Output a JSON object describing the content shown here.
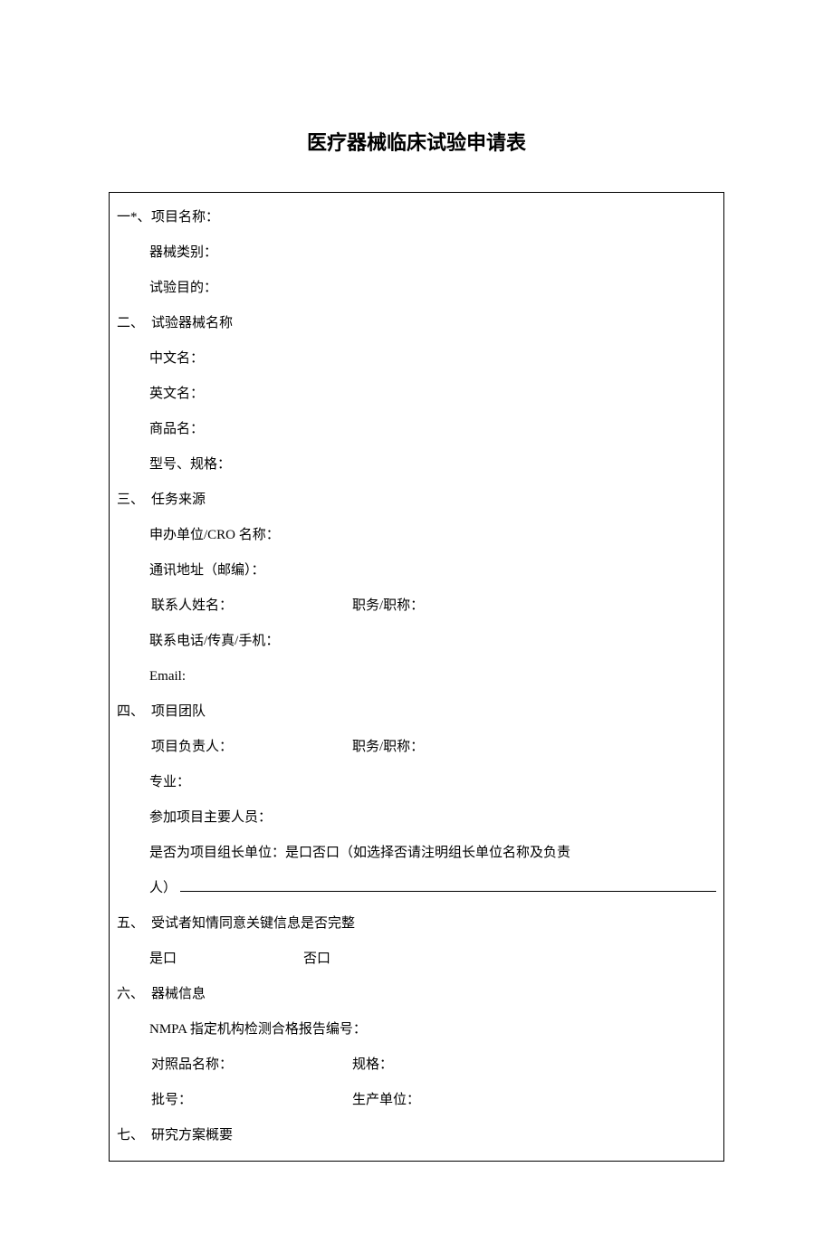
{
  "title": "医疗器械临床试验申请表",
  "sections": {
    "s1": {
      "num": "一*、",
      "title": "项目名称：",
      "f1": "器械类别：",
      "f2": "试验目的："
    },
    "s2": {
      "num": "二、",
      "title": "试验器械名称",
      "f1": "中文名：",
      "f2": "英文名：",
      "f3": "商品名：",
      "f4": "型号、规格："
    },
    "s3": {
      "num": "三、",
      "title": "任务来源",
      "f1": "申办单位/CRO 名称：",
      "f2": "通讯地址（邮编）：",
      "f3a": "联系人姓名：",
      "f3b": "职务/职称：",
      "f4": "联系电话/传真/手机：",
      "f5": "Email:"
    },
    "s4": {
      "num": "四、",
      "title": "项目团队",
      "f1a": "项目负责人：",
      "f1b": "职务/职称：",
      "f2": "专业：",
      "f3": "参加项目主要人员：",
      "f4": "是否为项目组长单位：是口否口（如选择否请注明组长单位名称及负责",
      "f5": "人）"
    },
    "s5": {
      "num": "五、",
      "title": "受试者知情同意关键信息是否完整",
      "opt1": "是口",
      "opt2": "否口"
    },
    "s6": {
      "num": "六、",
      "title": "器械信息",
      "f1": "NMPA 指定机构检测合格报告编号：",
      "f2a": "对照品名称：",
      "f2b": "规格：",
      "f3a": "批号：",
      "f3b": "生产单位："
    },
    "s7": {
      "num": "七、",
      "title": "研究方案概要"
    }
  }
}
